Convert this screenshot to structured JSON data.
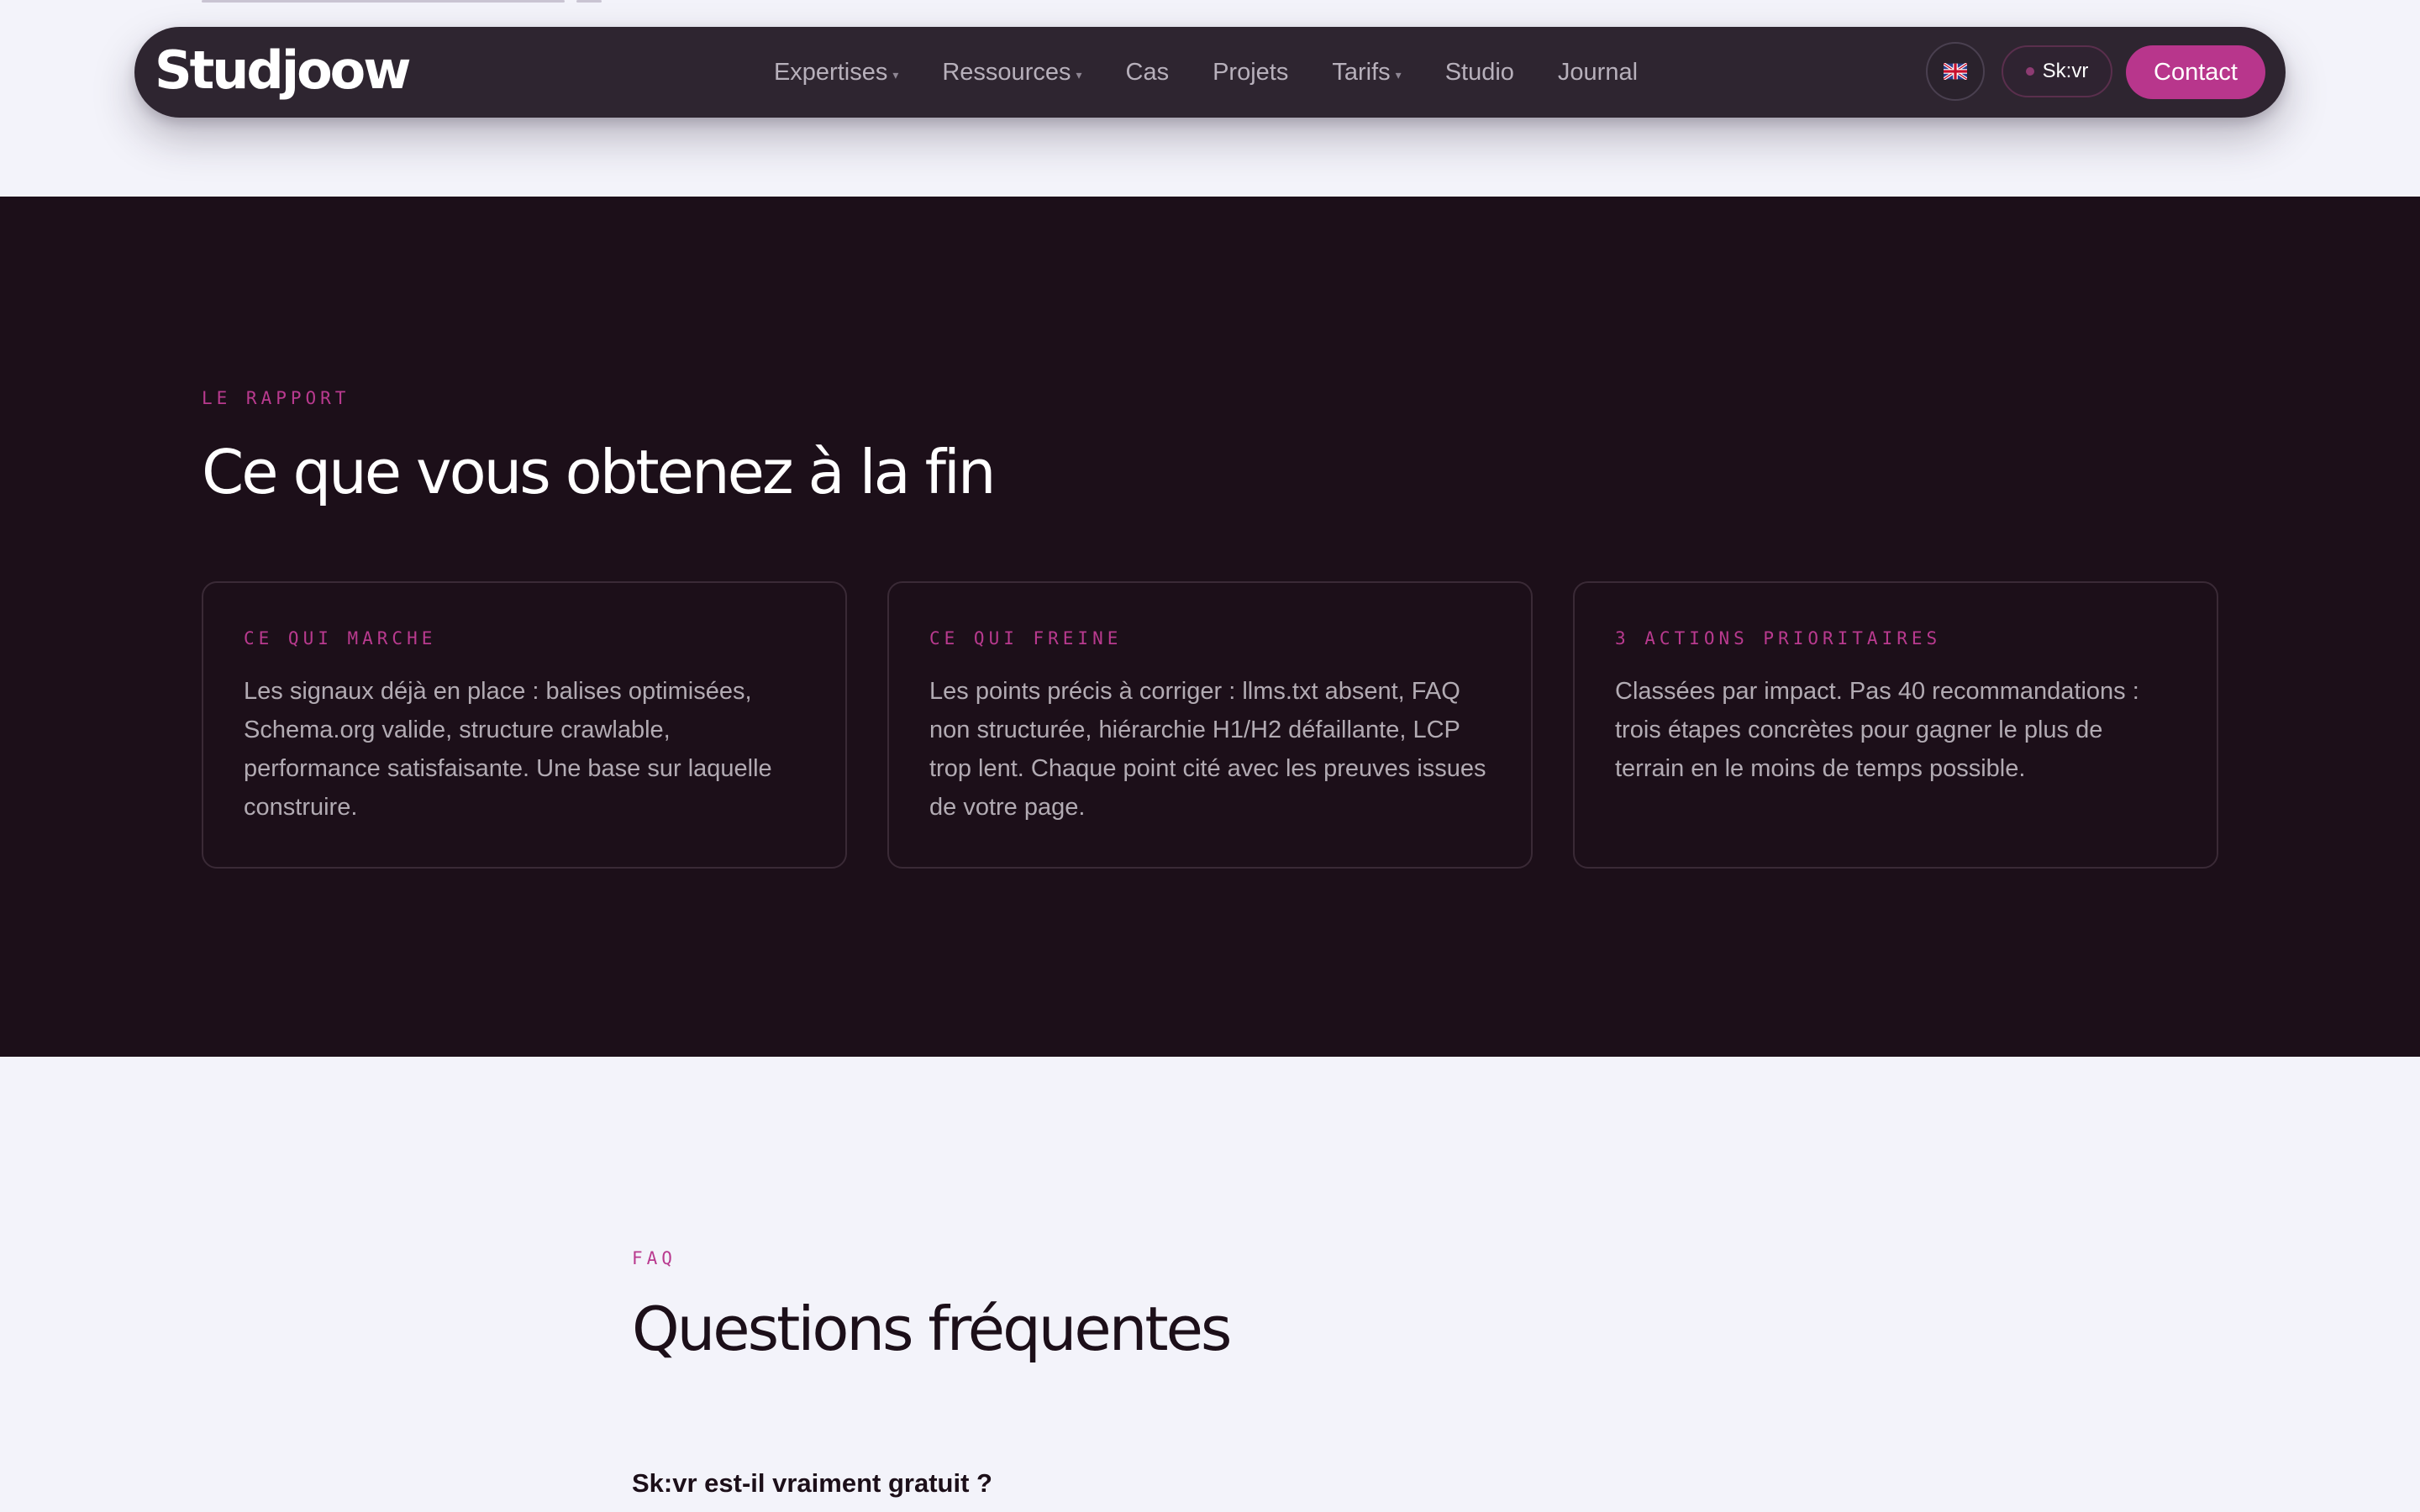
{
  "brand": {
    "logo_text": "Studjoow",
    "logo_prefix": "Stud",
    "logo_suffix": "joow",
    "accent_color": "#b8368c"
  },
  "nav": {
    "items": [
      {
        "label": "Expertises",
        "dropdown": true
      },
      {
        "label": "Ressources",
        "dropdown": true
      },
      {
        "label": "Cas",
        "dropdown": false
      },
      {
        "label": "Projets",
        "dropdown": false
      },
      {
        "label": "Tarifs",
        "dropdown": true
      },
      {
        "label": "Studio",
        "dropdown": false
      },
      {
        "label": "Journal",
        "dropdown": false
      }
    ],
    "language_icon": "uk-flag-icon",
    "tool_label": "Sk:vr",
    "contact_label": "Contact"
  },
  "report": {
    "eyebrow": "LE RAPPORT",
    "title": "Ce que vous obtenez à la fin",
    "cards": [
      {
        "label": "CE QUI MARCHE",
        "text": "Les signaux déjà en place : balises optimisées, Schema.org valide, structure crawlable, performance satisfaisante. Une base sur laquelle construire."
      },
      {
        "label": "CE QUI FREINE",
        "text": "Les points précis à corriger : llms.txt absent, FAQ non structurée, hiérarchie H1/H2 défaillante, LCP trop lent. Chaque point cité avec les preuves issues de votre page."
      },
      {
        "label": "3 ACTIONS PRIORITAIRES",
        "text": "Classées par impact. Pas 40 recommandations : trois étapes concrètes pour gagner le plus de terrain en le moins de temps possible."
      }
    ]
  },
  "faq": {
    "eyebrow": "FAQ",
    "title": "Questions fréquentes",
    "questions": [
      "Sk:vr est-il vraiment gratuit ?"
    ]
  }
}
